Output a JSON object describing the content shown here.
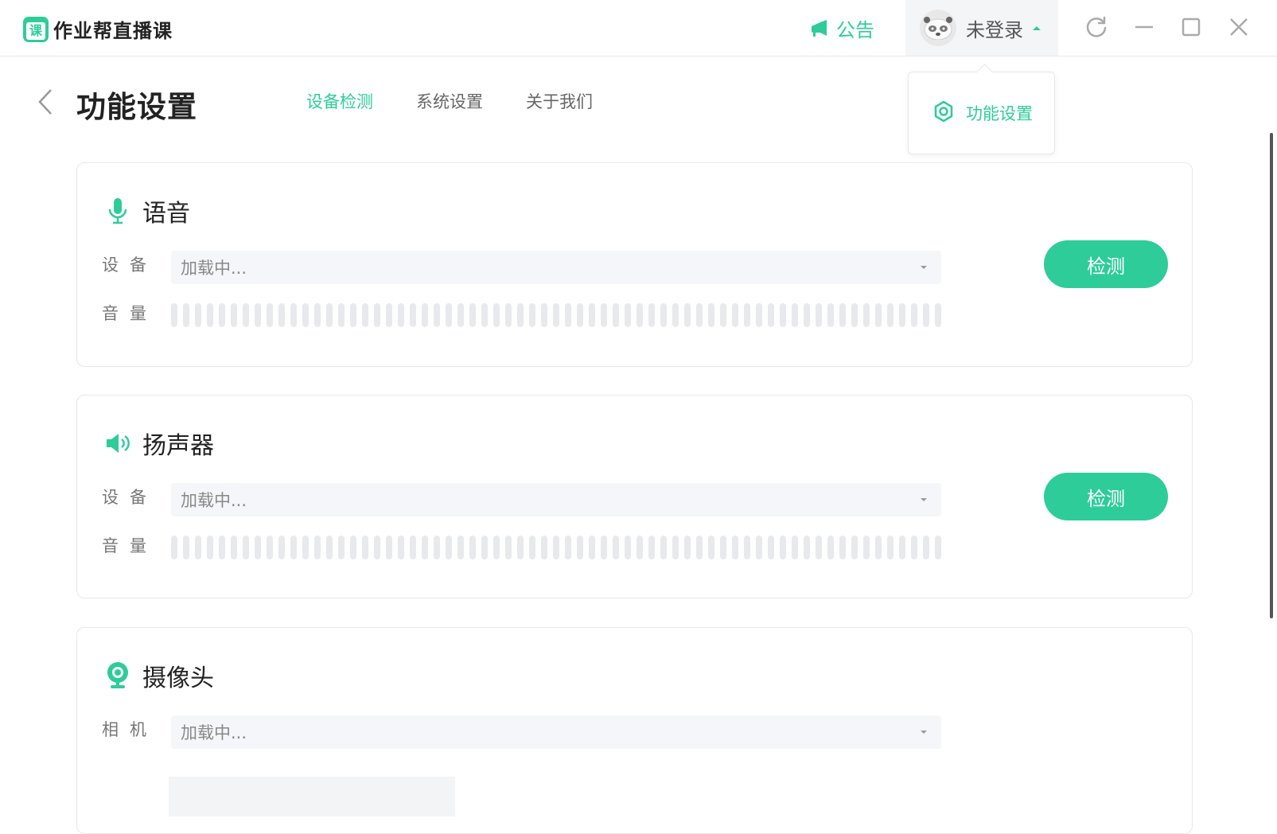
{
  "app": {
    "name": "作业帮直播课",
    "logo_glyph": "课"
  },
  "header": {
    "notice_label": "公告",
    "user_name": "未登录"
  },
  "page": {
    "title": "功能设置",
    "tabs": [
      {
        "label": "设备检测",
        "active": true
      },
      {
        "label": "系统设置",
        "active": false
      },
      {
        "label": "关于我们",
        "active": false
      }
    ]
  },
  "dropdown": {
    "item_label": "功能设置"
  },
  "voice": {
    "title": "语音",
    "device_label": "设备",
    "device_value": "加载中...",
    "volume_label": "音量",
    "check_label": "检测"
  },
  "speaker": {
    "title": "扬声器",
    "device_label": "设备",
    "device_value": "加载中...",
    "volume_label": "音量",
    "check_label": "检测"
  },
  "camera": {
    "title": "摄像头",
    "camera_label": "相机",
    "camera_value": "加载中..."
  },
  "colors": {
    "accent": "#2ecc99"
  },
  "icons": [
    "announce-icon",
    "avatar-icon",
    "refresh-icon",
    "minimize-icon",
    "maximize-icon",
    "close-icon",
    "back-icon",
    "settings-icon",
    "microphone-icon",
    "speaker-icon",
    "camera-icon"
  ]
}
